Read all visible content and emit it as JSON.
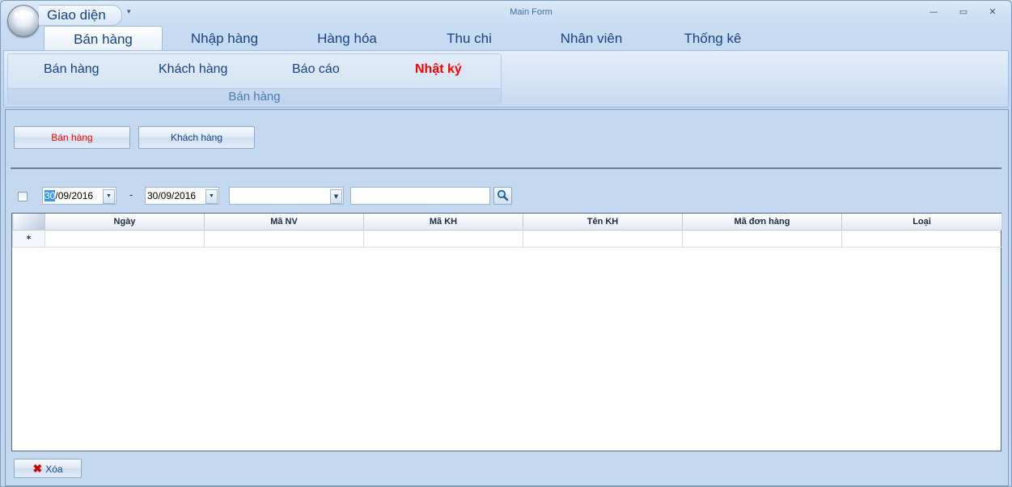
{
  "app": {
    "orb_title": "Giao diện",
    "window_title": "Main Form",
    "qat_dropdown_glyph": "▾",
    "minimize_glyph": "—",
    "maximize_glyph": "▭",
    "close_glyph": "✕"
  },
  "ribbon": {
    "tabs": [
      "Bán hàng",
      "Nhập hàng",
      "Hàng hóa",
      "Thu chi",
      "Nhân viên",
      "Thống kê"
    ],
    "active_tab": "Bán hàng",
    "group": {
      "buttons": [
        "Bán hàng",
        "Khách hàng",
        "Báo cáo",
        "Nhật ký"
      ],
      "highlighted": "Nhật ký",
      "label": "Bán hàng"
    }
  },
  "content": {
    "buttons": [
      "Bán hàng",
      "Khách hàng"
    ],
    "filter": {
      "checkbox_checked": false,
      "from_date_day": "30",
      "from_date_rest": "/09/2016",
      "to_date": "30/09/2016",
      "separator": "-",
      "combo_value": "",
      "search_value": ""
    },
    "grid": {
      "columns": [
        "Ngày",
        "Mã NV",
        "Mã KH",
        "Tên KH",
        "Mã đơn hàng",
        "Loại"
      ],
      "new_row_marker": "*",
      "rows": []
    },
    "delete_label": "Xóa"
  },
  "colors": {
    "highlight_red": "#ff0000",
    "ribbon_text": "#15428b",
    "selection_blue": "#3399ff"
  },
  "icons": {
    "delete": "x-icon",
    "search": "magnifier-icon",
    "dropdown": "chevron-down-icon"
  }
}
